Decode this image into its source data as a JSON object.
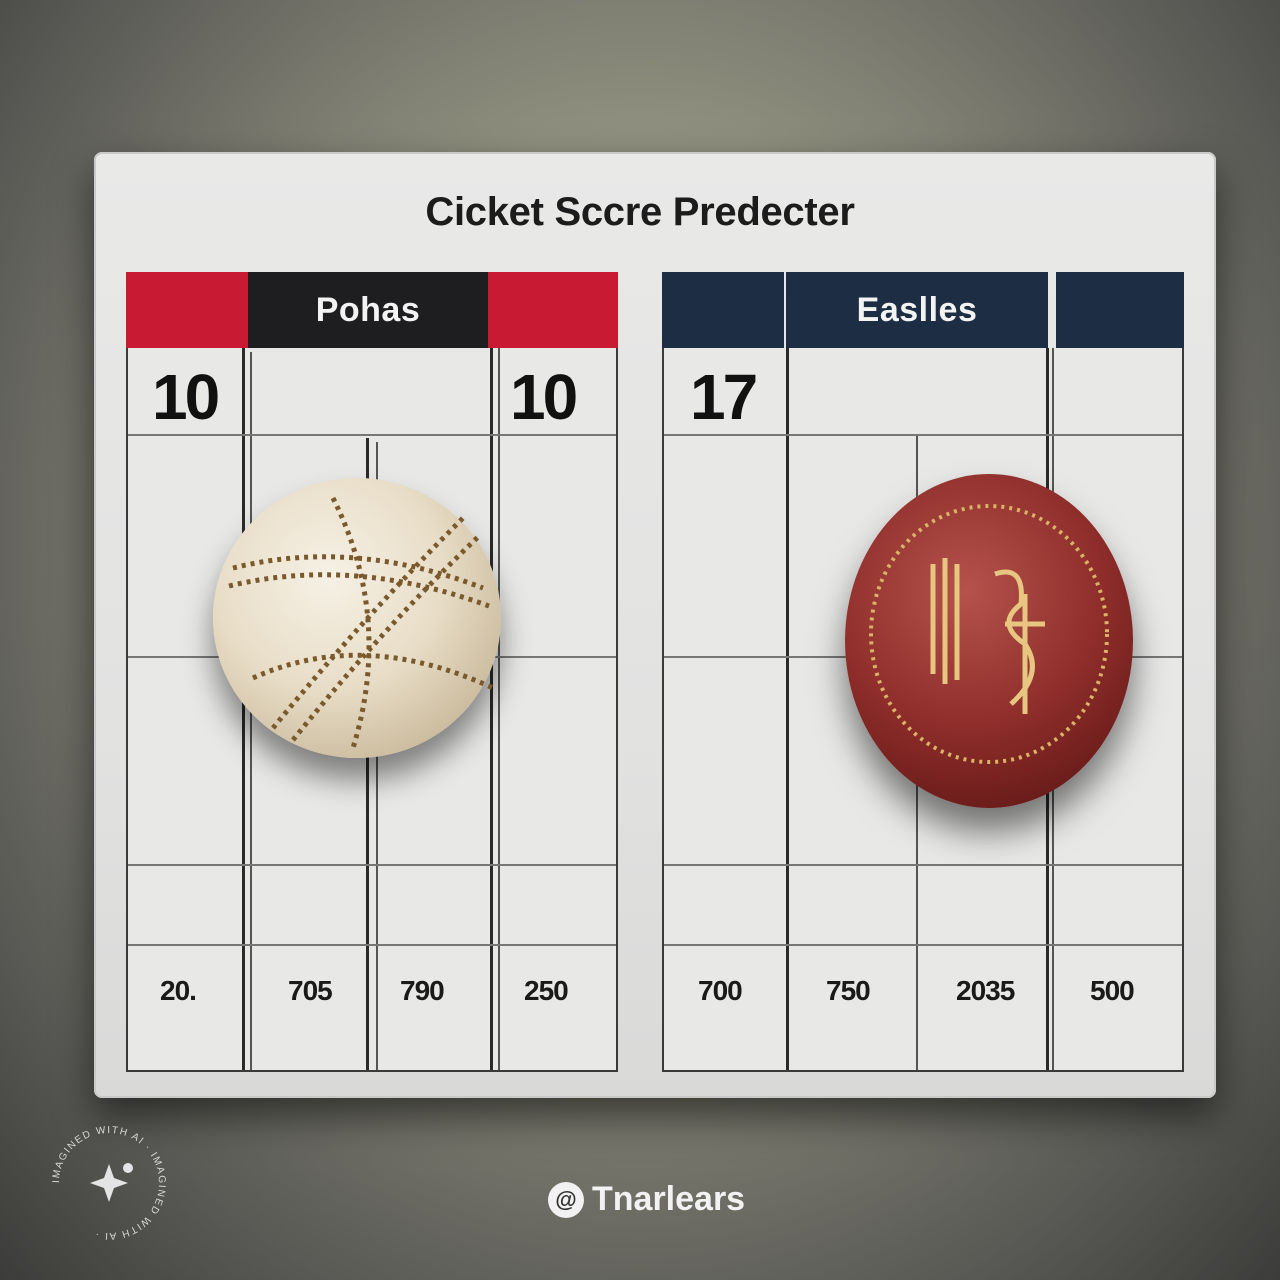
{
  "title": "Cicket Sccre Predecter",
  "colors": {
    "team_a_accent": "#c91a34",
    "team_a_dark": "#1e1e20",
    "team_b_accent": "#1d2e44",
    "team_b_dark": "#1d2e44"
  },
  "team_a": {
    "name": "Pohas",
    "score_left": "10",
    "score_right": "10",
    "footer": [
      "20.",
      "705",
      "790",
      "250"
    ]
  },
  "team_b": {
    "name": "Easlles",
    "score_left": "17",
    "footer": [
      "700",
      "750",
      "2035",
      "500"
    ]
  },
  "brand": {
    "name": "Tnarlears",
    "icon": "brand-swirl-icon"
  },
  "watermark": {
    "text": "IMAGINED WITH AI · IMAGINED WITH AI ·",
    "icon": "sparkle-icon"
  }
}
